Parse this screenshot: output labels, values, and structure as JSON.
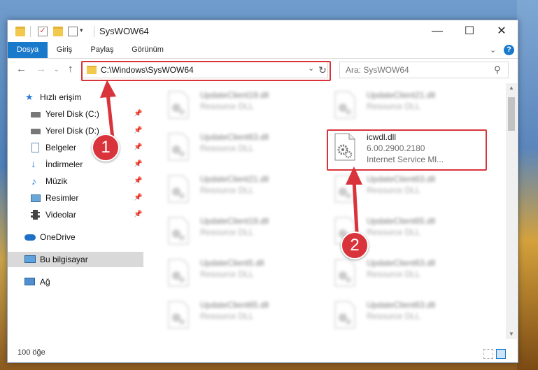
{
  "window": {
    "title": "SysWOW64",
    "controls": {
      "minimize": "—",
      "maximize": "☐",
      "close": "✕"
    }
  },
  "ribbon": {
    "tabs": [
      "Dosya",
      "Giriş",
      "Paylaş",
      "Görünüm"
    ],
    "help": "?"
  },
  "address": {
    "path": "C:\\Windows\\SysWOW64",
    "search_placeholder": "Ara: SysWOW64"
  },
  "sidebar": {
    "quick_access": "Hızlı erişim",
    "items": [
      "Yerel Disk (C:)",
      "Yerel Disk (D:)",
      "Belgeler",
      "İndirmeler",
      "Müzik",
      "Resimler",
      "Videolar"
    ],
    "onedrive": "OneDrive",
    "this_pc": "Bu bilgisayar",
    "network": "Ağ"
  },
  "files": {
    "highlighted": {
      "name": "icwdl.dll",
      "version": "6.00.2900.2180",
      "description": "Internet Service Ml..."
    },
    "left_column": [
      {
        "name": "UpdateClient19.dll",
        "type": "Resource DLL"
      },
      {
        "name": "UpdateClient63.dll",
        "type": "Resource DLL"
      },
      {
        "name": "UpdateClient21.dll",
        "type": "Resource DLL"
      },
      {
        "name": "UpdateClient19.dll",
        "type": "Resource DLL"
      },
      {
        "name": "UpdateClient5.dll",
        "type": "Resource DLL"
      },
      {
        "name": "UpdateClient65.dll",
        "type": "Resource DLL"
      }
    ],
    "right_column": [
      {
        "name": "UpdateClient21.dll",
        "type": "Resource DLL"
      },
      {
        "name": "UpdateClient63.dll",
        "type": "Resource DLL"
      },
      {
        "name": "UpdateClient65.dll",
        "type": "Resource DLL"
      },
      {
        "name": "UpdateClient63.dll",
        "type": "Resource DLL"
      },
      {
        "name": "UpdateClient63.dll",
        "type": "Resource DLL"
      }
    ]
  },
  "status": {
    "item_count": "100 öğe"
  },
  "annotations": {
    "step1": "1",
    "step2": "2",
    "accent": "#d9343c"
  }
}
